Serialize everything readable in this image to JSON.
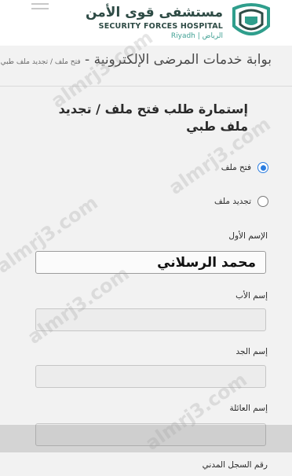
{
  "header": {
    "hospital_name_ar": "مستشفى قوى الأمن",
    "hospital_name_en": "SECURITY FORCES HOSPITAL",
    "city": "Riyadh | الرياض"
  },
  "portal": {
    "title": "بوابة خدمات المرضى الإلكترونية -",
    "breadcrumb": "فتح ملف / تجديد ملف طبي"
  },
  "form": {
    "title": "إستمارة طلب فتح ملف / تجديد ملف طبي",
    "request_type_options": [
      {
        "label": "فتح ملف",
        "selected": true
      },
      {
        "label": "تجديد ملف",
        "selected": false
      }
    ],
    "fields": [
      {
        "label": "الإسم الأول",
        "value": "محمد الرسلاني"
      },
      {
        "label": "إسم الأب",
        "value": ""
      },
      {
        "label": "إسم الجد",
        "value": ""
      },
      {
        "label": "إسم العائلة",
        "value": ""
      },
      {
        "label": "رقم السجل المدني",
        "value": ""
      }
    ]
  },
  "watermark": "almrj3.com",
  "colors": {
    "accent": "#2b7de0",
    "brand": "#2e4b45",
    "brand_light": "#3fa093"
  }
}
